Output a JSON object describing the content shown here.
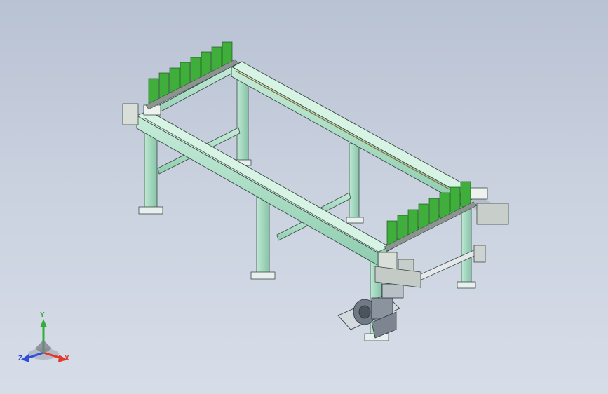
{
  "viewport": {
    "background_top": "#b9c2d3",
    "background_bottom": "#d7dde8",
    "frame_color": "#a9dcc3",
    "frame_edge_color": "#3c4a46",
    "holder_color": "#3fae3a",
    "motor_color": "#6f7a86"
  },
  "triad": {
    "x_label": "X",
    "y_label": "Y",
    "z_label": "Z",
    "x_color": "#e23a2a",
    "y_color": "#2fae3a",
    "z_color": "#2f4fd6"
  }
}
